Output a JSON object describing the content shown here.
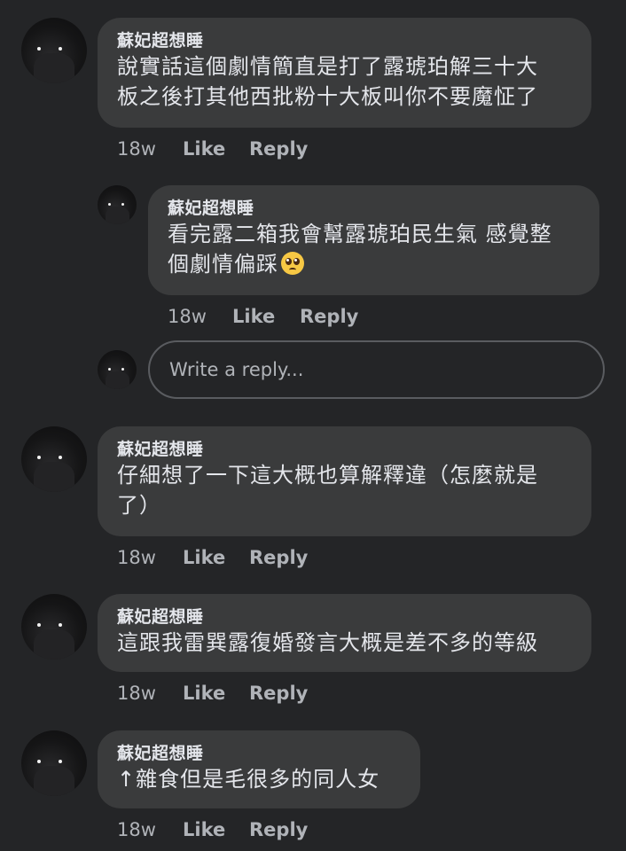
{
  "comments": [
    {
      "author": "蘇妃超想睡",
      "lines": [
        "說實話這個劇情簡直是打了露琥珀解三十大",
        "板之後打其他西批粉十大板叫你不要魔怔了"
      ],
      "time": "18w",
      "like": "Like",
      "reply": "Reply"
    },
    {
      "author": "蘇妃超想睡",
      "lines": [
        "看完露二箱我會幫露琥珀民生氣 感覺整",
        "個劇情偏踩"
      ],
      "emoji": "pleading-face",
      "time": "18w",
      "like": "Like",
      "reply": "Reply"
    },
    {
      "author": "蘇妃超想睡",
      "lines": [
        "仔細想了一下這大概也算解釋違（怎麼就是",
        "了）"
      ],
      "time": "18w",
      "like": "Like",
      "reply": "Reply"
    },
    {
      "author": "蘇妃超想睡",
      "lines": [
        "這跟我雷巽露復婚發言大概是差不多的等級"
      ],
      "time": "18w",
      "like": "Like",
      "reply": "Reply"
    },
    {
      "author": "蘇妃超想睡",
      "lines": [
        "↑雜食但是毛很多的同人女"
      ],
      "time": "18w",
      "like": "Like",
      "reply": "Reply"
    }
  ],
  "reply_box": {
    "placeholder": "Write a reply..."
  },
  "colors": {
    "background": "#242527",
    "bubble": "#3a3b3c",
    "text": "#e4e6eb",
    "muted": "#b0b3b8"
  }
}
